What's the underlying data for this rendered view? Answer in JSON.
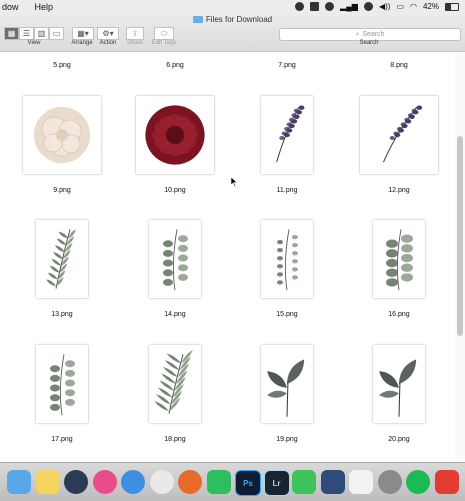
{
  "menubar": {
    "left_items": [
      "dow",
      "Help"
    ],
    "battery": "42%",
    "status_icons": [
      "camera-icon",
      "stop-record-icon",
      "creative-cloud-icon",
      "wifi-signal-icon",
      "dropbox-icon",
      "speaker-icon",
      "cast-icon",
      "wifi-icon"
    ]
  },
  "window": {
    "title": "Files for Download"
  },
  "toolbar": {
    "view_label": "View",
    "arrange_label": "Arrange",
    "action_label": "Action",
    "share_label": "Share",
    "edit_tags_label": "Edit Tags",
    "search_label": "Search",
    "search_placeholder": "Search"
  },
  "files": [
    {
      "name": "5.png",
      "art": "none"
    },
    {
      "name": "6.png",
      "art": "none"
    },
    {
      "name": "7.png",
      "art": "none"
    },
    {
      "name": "8.png",
      "art": "none"
    },
    {
      "name": "9.png",
      "art": "rose"
    },
    {
      "name": "10.png",
      "art": "dahlia"
    },
    {
      "name": "11.png",
      "art": "lavender"
    },
    {
      "name": "12.png",
      "art": "lavender"
    },
    {
      "name": "13.png",
      "art": "fern"
    },
    {
      "name": "14.png",
      "art": "eucalyptus"
    },
    {
      "name": "15.png",
      "art": "sprig"
    },
    {
      "name": "16.png",
      "art": "leafy"
    },
    {
      "name": "17.png",
      "art": "eucalyptus"
    },
    {
      "name": "18.png",
      "art": "willow"
    },
    {
      "name": "19.png",
      "art": "bigleaf"
    },
    {
      "name": "20.png",
      "art": "bigleaf"
    }
  ],
  "colors": {
    "rose": "#e9dccd",
    "dahlia": "#7b1420",
    "lavender": "#4a3d63",
    "greenery": "#5d6f5a",
    "dark_leaf": "#2f3a32",
    "folder": "#68aee8"
  },
  "dock": {
    "apps": [
      "finder-app-icon",
      "notes-app-icon",
      "quicktime-app-icon",
      "itunes-app-icon",
      "safari-app-icon",
      "chrome-app-icon",
      "firefox-app-icon",
      "evernote-app-icon",
      "photoshop-app-icon",
      "lightroom-app-icon",
      "facetime-app-icon",
      "vnc-app-icon",
      "charts-app-icon",
      "system-preferences-app-icon",
      "spotify-app-icon",
      "creative-cloud-app-icon"
    ],
    "photoshop_text": "Ps",
    "lightroom_text": "Lr"
  }
}
